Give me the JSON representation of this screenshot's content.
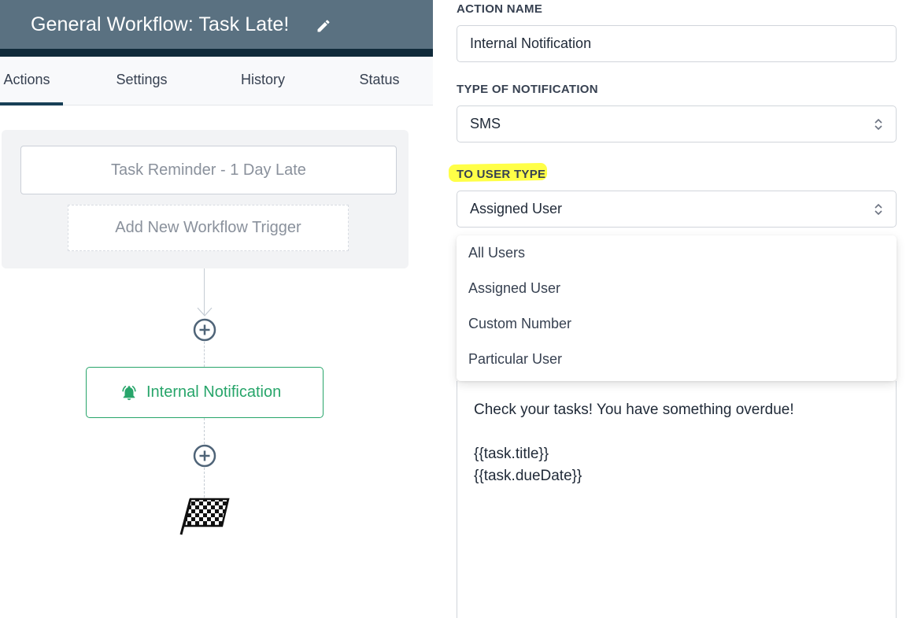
{
  "header": {
    "title": "General Workflow: Task Late!"
  },
  "tabs": [
    {
      "label": "Actions",
      "active": true
    },
    {
      "label": "Settings",
      "active": false
    },
    {
      "label": "History",
      "active": false
    },
    {
      "label": "Status",
      "active": false
    }
  ],
  "workflow": {
    "trigger_label": "Task Reminder - 1 Day Late",
    "add_trigger_label": "Add New Workflow Trigger",
    "action_label": "Internal Notification"
  },
  "form": {
    "action_name_label": "ACTION NAME",
    "action_name_value": "Internal Notification",
    "notification_type_label": "TYPE OF NOTIFICATION",
    "notification_type_value": "SMS",
    "user_type_label": "TO USER TYPE",
    "user_type_value": "Assigned User",
    "user_type_options": [
      "All Users",
      "Assigned User",
      "Custom Number",
      "Particular User"
    ],
    "message_lines": [
      "Check your tasks! You have something overdue!",
      "{{task.title}}",
      "{{task.dueDate}}"
    ]
  },
  "colors": {
    "header_bg": "#5a7181",
    "header_dark": "#102a3a",
    "accent_green": "#27a56a",
    "highlight": "#ffff33"
  }
}
